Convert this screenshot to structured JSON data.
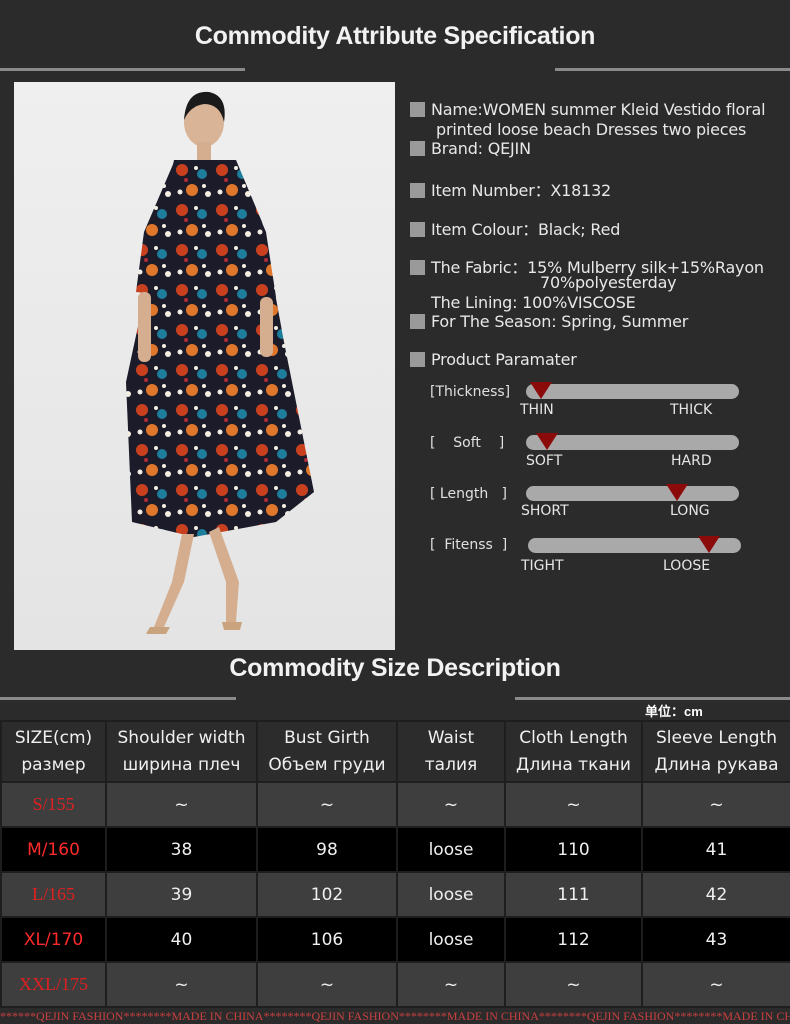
{
  "attr_title": "Commodity Attribute Specification",
  "size_title": "Commodity Size Description",
  "specs": {
    "name_line1": "Name:WOMEN summer Kleid  Vestido floral",
    "name_line2": "printed loose beach Dresses two pieces",
    "brand": "Brand: QEJIN",
    "item_number": "Item Number：X18132",
    "item_colour": "Item Colour：Black;  Red",
    "fabric_line1": "The Fabric：15% Mulberry silk+15%Rayon",
    "fabric_line2": "70%polyesterday",
    "lining": "The Lining: 100%VISCOSE",
    "season": "For The Season:  Spring, Summer",
    "product_param": "Product Paramater"
  },
  "params": [
    {
      "label": "[Thickness]",
      "left": "THIN",
      "right": "THICK",
      "level": 0.07
    },
    {
      "label": "[    Soft    ]",
      "left": "SOFT",
      "right": "HARD",
      "level": 0.1
    },
    {
      "label": "[ Length   ]",
      "left": "SHORT",
      "right": "LONG",
      "level": 0.71
    },
    {
      "label": "[  Fitenss  ]",
      "left": "TIGHT",
      "right": "LOOSE",
      "level": 0.85
    }
  ],
  "unit": "单位：cm",
  "table": {
    "headers": [
      [
        "SIZE(cm)",
        "размер"
      ],
      [
        "Shoulder width",
        "ширина плеч"
      ],
      [
        "Bust Girth",
        "Объем груди"
      ],
      [
        "Waist",
        "талия"
      ],
      [
        "Cloth Length",
        "Длина ткани"
      ],
      [
        "Sleeve Length",
        "Длина рукава"
      ]
    ],
    "rows": [
      [
        "S/155",
        "~",
        "~",
        "~",
        "~",
        "~"
      ],
      [
        "M/160",
        "38",
        "98",
        "loose",
        "110",
        "41"
      ],
      [
        "L/165",
        "39",
        "102",
        "loose",
        "111",
        "42"
      ],
      [
        "XL/170",
        "40",
        "106",
        "loose",
        "112",
        "43"
      ],
      [
        "XXL/175",
        "~",
        "~",
        "~",
        "~",
        "~"
      ]
    ]
  },
  "footer": "******QEJIN FASHION********MADE IN CHINA********QEJIN FASHION********MADE IN CHINA********QEJIN FASHION********MADE IN CHINA******",
  "colors": {
    "background": "#2b2b2b",
    "marker": "#8b0a0a",
    "size_red": "#e02020"
  }
}
